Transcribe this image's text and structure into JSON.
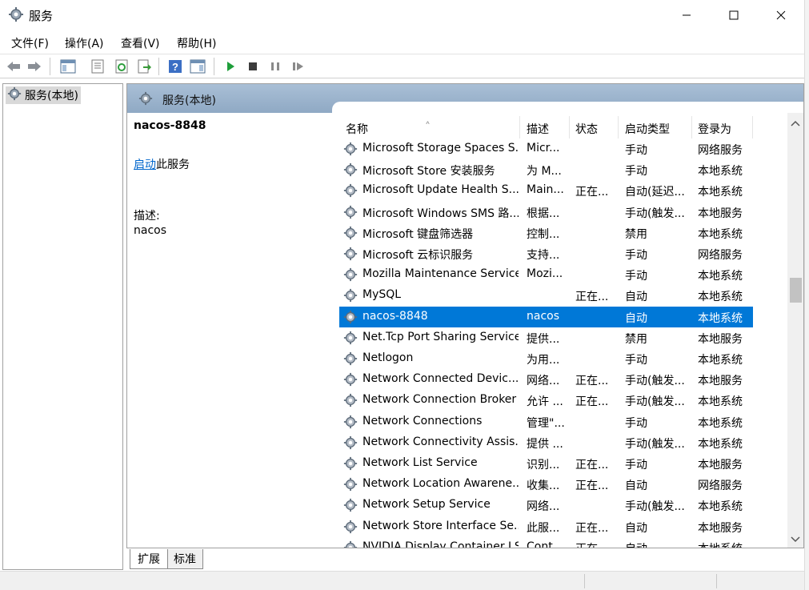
{
  "window": {
    "title": "服务",
    "icon": "gear-icon"
  },
  "menu": [
    "文件(F)",
    "操作(A)",
    "查看(V)",
    "帮助(H)"
  ],
  "toolbar_icons": [
    "back-arrow-icon",
    "forward-arrow-icon",
    "show-console-tree-icon",
    "properties-icon",
    "refresh-icon",
    "export-list-icon",
    "help-icon",
    "show-hide-action-pane-icon",
    "start-service-icon",
    "stop-service-icon",
    "pause-service-icon",
    "restart-service-icon"
  ],
  "tree": {
    "root_label": "服务(本地)"
  },
  "pane": {
    "header": "服务(本地)"
  },
  "extended": {
    "service_name": "nacos-8848",
    "action_link": "启动",
    "action_suffix": "此服务",
    "desc_label": "描述:",
    "desc_value": "nacos"
  },
  "columns": [
    "名称",
    "描述",
    "状态",
    "启动类型",
    "登录为"
  ],
  "services": [
    {
      "name": "Microsoft Storage Spaces S...",
      "desc": "Micr...",
      "status": "",
      "start": "手动",
      "logon": "网络服务"
    },
    {
      "name": "Microsoft Store 安装服务",
      "desc": "为 M...",
      "status": "",
      "start": "手动",
      "logon": "本地系统"
    },
    {
      "name": "Microsoft Update Health S...",
      "desc": "Main...",
      "status": "正在...",
      "start": "自动(延迟...",
      "logon": "本地系统"
    },
    {
      "name": "Microsoft Windows SMS 路...",
      "desc": "根据...",
      "status": "",
      "start": "手动(触发...",
      "logon": "本地服务"
    },
    {
      "name": "Microsoft 键盘筛选器",
      "desc": "控制...",
      "status": "",
      "start": "禁用",
      "logon": "本地系统"
    },
    {
      "name": "Microsoft 云标识服务",
      "desc": "支持...",
      "status": "",
      "start": "手动",
      "logon": "网络服务"
    },
    {
      "name": "Mozilla Maintenance Service",
      "desc": "Mozi...",
      "status": "",
      "start": "手动",
      "logon": "本地系统"
    },
    {
      "name": "MySQL",
      "desc": "",
      "status": "正在...",
      "start": "自动",
      "logon": "本地系统"
    },
    {
      "name": "nacos-8848",
      "desc": "nacos",
      "status": "",
      "start": "自动",
      "logon": "本地系统",
      "selected": true
    },
    {
      "name": "Net.Tcp Port Sharing Service",
      "desc": "提供...",
      "status": "",
      "start": "禁用",
      "logon": "本地服务"
    },
    {
      "name": "Netlogon",
      "desc": "为用...",
      "status": "",
      "start": "手动",
      "logon": "本地系统"
    },
    {
      "name": "Network Connected Devic...",
      "desc": "网络...",
      "status": "正在...",
      "start": "手动(触发...",
      "logon": "本地服务"
    },
    {
      "name": "Network Connection Broker",
      "desc": "允许 ...",
      "status": "正在...",
      "start": "手动(触发...",
      "logon": "本地系统"
    },
    {
      "name": "Network Connections",
      "desc": "管理\"...",
      "status": "",
      "start": "手动",
      "logon": "本地系统"
    },
    {
      "name": "Network Connectivity Assis...",
      "desc": "提供 ...",
      "status": "",
      "start": "手动(触发...",
      "logon": "本地系统"
    },
    {
      "name": "Network List Service",
      "desc": "识别...",
      "status": "正在...",
      "start": "手动",
      "logon": "本地服务"
    },
    {
      "name": "Network Location Awarene...",
      "desc": "收集...",
      "status": "正在...",
      "start": "自动",
      "logon": "网络服务"
    },
    {
      "name": "Network Setup Service",
      "desc": "网络...",
      "status": "",
      "start": "手动(触发...",
      "logon": "本地系统"
    },
    {
      "name": "Network Store Interface Se...",
      "desc": "此服...",
      "status": "正在...",
      "start": "自动",
      "logon": "本地服务"
    },
    {
      "name": "NVIDIA Display Container LS",
      "desc": "Cont...",
      "status": "正在...",
      "start": "自动",
      "logon": "本地系统"
    }
  ],
  "tabs": [
    "扩展",
    "标准"
  ],
  "colors": {
    "selection": "#0078d7",
    "link": "#0066cc",
    "header_band": "#9db5cf"
  }
}
